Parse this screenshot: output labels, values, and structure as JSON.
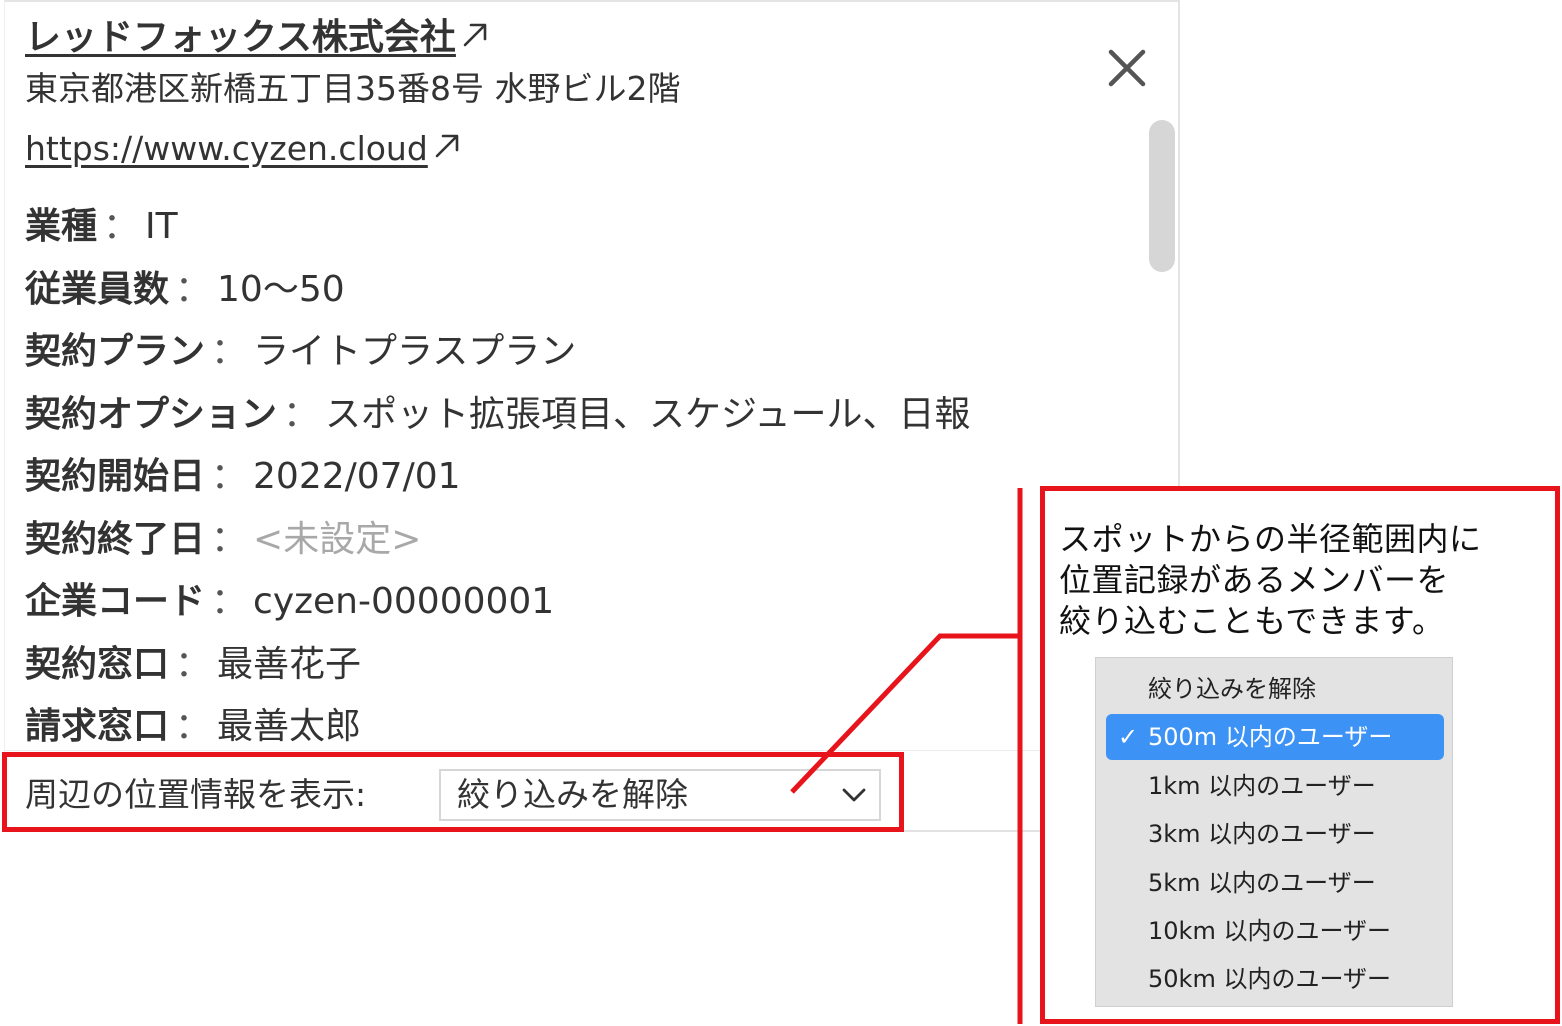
{
  "popup": {
    "company_name": "レッドフォックス株式会社",
    "address": "東京都港区新橋五丁目35番8号 水野ビル2階",
    "website": "https://www.cyzen.cloud",
    "separator": "：",
    "fields": [
      {
        "label": "業種",
        "value": "IT"
      },
      {
        "label": "従業員数",
        "value": "10〜50"
      },
      {
        "label": "契約プラン",
        "value": "ライトプラスプラン"
      },
      {
        "label": "契約オプション",
        "value": "スポット拡張項目、スケジュール、日報"
      },
      {
        "label": "契約開始日",
        "value": "2022/07/01"
      },
      {
        "label": "契約終了日",
        "value": "<未設定>"
      },
      {
        "label": "企業コード",
        "value": "cyzen-00000001"
      },
      {
        "label": "契約窓口",
        "value": "最善花子"
      },
      {
        "label": "請求窓口",
        "value": "最善太郎"
      }
    ],
    "nearby": {
      "label": "周辺の位置情報を表示:",
      "selected": "絞り込みを解除"
    }
  },
  "callout": {
    "lines": [
      "スポットからの半径範囲内に",
      "位置記録があるメンバーを",
      "絞り込むこともできます。"
    ],
    "menu": {
      "check": "✓",
      "options": [
        "絞り込みを解除",
        "500m 以内のユーザー",
        "1km 以内のユーザー",
        "3km 以内のユーザー",
        "5km 以内のユーザー",
        "10km 以内のユーザー",
        "50km 以内のユーザー"
      ],
      "selected_index": 1
    }
  },
  "colors": {
    "annotation_red": "#e8141b",
    "menu_selected": "#3d92f5",
    "menu_background": "#e3e3e3",
    "unset_text": "#a8a8a8"
  },
  "icons": {
    "external_link": "external-link-icon",
    "close": "close-icon",
    "dropdown": "chevron-down-icon",
    "checkmark": "checkmark-icon"
  }
}
